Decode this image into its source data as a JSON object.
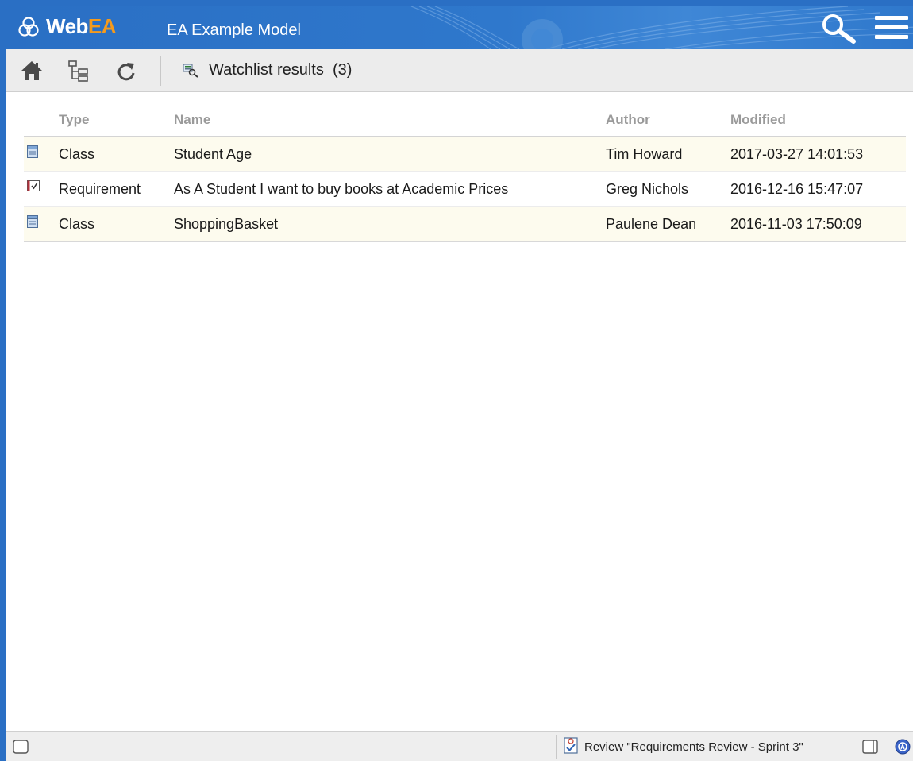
{
  "header": {
    "logo_web": "Web",
    "logo_ea": "EA",
    "model_title": "EA Example Model",
    "icons": [
      "logo-icon",
      "search-icon",
      "hamburger-menu-icon"
    ]
  },
  "toolbar": {
    "icons": [
      "home-icon",
      "tree-icon",
      "refresh-icon",
      "watchlist-icon"
    ],
    "title": "Watchlist results",
    "count": "(3)"
  },
  "table": {
    "columns": [
      "Type",
      "Name",
      "Author",
      "Modified"
    ],
    "rows": [
      {
        "icon": "class-icon",
        "type": "Class",
        "name": "Student Age",
        "author": "Tim Howard",
        "modified": "2017-03-27 14:01:53"
      },
      {
        "icon": "requirement-icon",
        "type": "Requirement",
        "name": "As A Student I want to buy books at Academic Prices",
        "author": "Greg Nichols",
        "modified": "2016-12-16 15:47:07"
      },
      {
        "icon": "class-icon",
        "type": "Class",
        "name": "ShoppingBasket",
        "author": "Paulene Dean",
        "modified": "2016-11-03 17:50:09"
      }
    ]
  },
  "statusbar": {
    "review": "Review \"Requirements Review - Sprint 3\"",
    "icons": [
      "panel-toggle-icon",
      "review-icon",
      "panel-right-icon",
      "user-avatar-icon"
    ]
  },
  "colors": {
    "header_blue": "#2a6fc4",
    "logo_accent": "#f59a1c",
    "row_highlight": "#fdfbee"
  }
}
